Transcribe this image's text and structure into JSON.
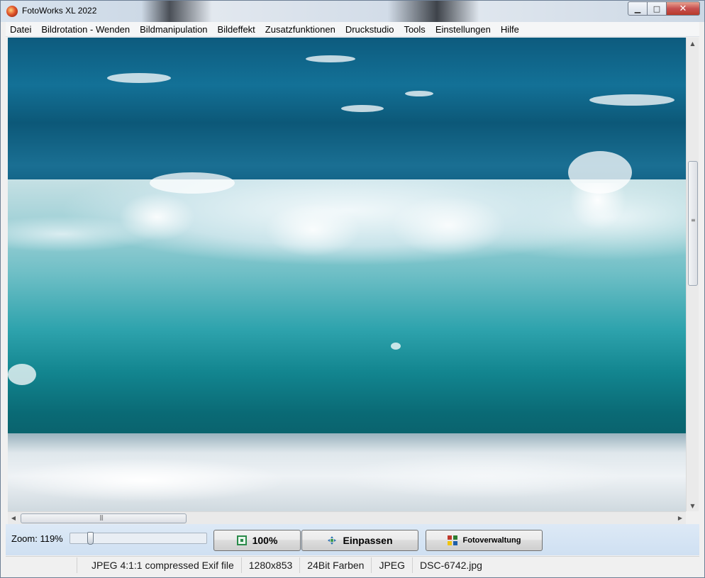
{
  "window": {
    "title": "FotoWorks XL 2022"
  },
  "titlebar_buttons": {
    "minimize": "▁",
    "maximize": "□",
    "close": "✕"
  },
  "menu": [
    {
      "label": "Datei"
    },
    {
      "label": "Bildrotation - Wenden"
    },
    {
      "label": "Bildmanipulation"
    },
    {
      "label": "Bildeffekt"
    },
    {
      "label": "Zusatzfunktionen"
    },
    {
      "label": "Druckstudio"
    },
    {
      "label": "Tools"
    },
    {
      "label": "Einstellungen"
    },
    {
      "label": "Hilfe"
    }
  ],
  "viewer": {
    "image_subject": "ocean wave",
    "zoom_percent": 119
  },
  "scrollbars": {
    "vertical": {
      "position_fraction": 0.28,
      "visible_fraction": 0.27
    },
    "horizontal": {
      "position_fraction": 0.0,
      "visible_fraction": 0.25
    }
  },
  "toolbar": {
    "zoom_label": "Zoom: 119%",
    "zoom_slider_fraction": 0.13,
    "btn_100": "100%",
    "btn_fit": "Einpassen",
    "btn_manager": "Fotoverwaltung"
  },
  "status": {
    "format": "JPEG 4:1:1 compressed Exif file",
    "dimensions": "1280x853",
    "colors": "24Bit Farben",
    "type": "JPEG",
    "filename": "DSC-6742.jpg"
  },
  "colors": {
    "toolbar_bg": "#dde9f6",
    "close_red": "#c75050"
  }
}
